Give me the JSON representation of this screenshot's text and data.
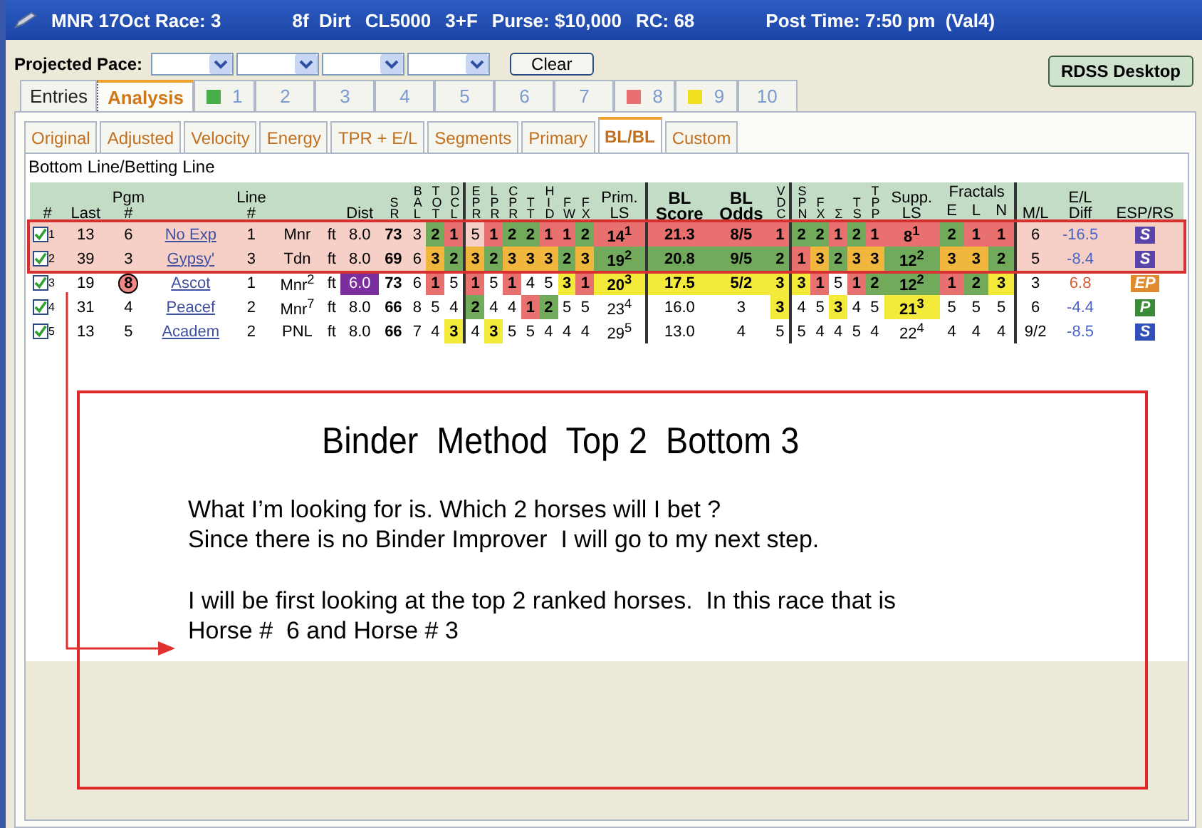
{
  "title_bar": {
    "parts": [
      "MNR 17Oct Race: 3",
      "8f  Dirt",
      "CL5000",
      "3+F",
      "Purse: $10,000",
      "RC: 68",
      "Post Time: 7:50 pm  (Val4)"
    ]
  },
  "toolbar": {
    "label": "Projected Pace:",
    "selects": [
      {
        "kind": "dropdown"
      },
      {
        "kind": "dropdown"
      },
      {
        "kind": "dropdown"
      },
      {
        "kind": "dropdown"
      }
    ],
    "clear_button": "Clear",
    "desktop_button": "RDSS Desktop"
  },
  "tabs": [
    {
      "label": "Entries",
      "selected": false
    },
    {
      "label": "Analysis",
      "selected": true
    },
    {
      "label": "1",
      "selected": false,
      "color": "#48b048"
    },
    {
      "label": "2",
      "selected": false
    },
    {
      "label": "3",
      "selected": false
    },
    {
      "label": "4",
      "selected": false
    },
    {
      "label": "5",
      "selected": false
    },
    {
      "label": "6",
      "selected": false
    },
    {
      "label": "7",
      "selected": false
    },
    {
      "label": "8",
      "selected": false,
      "color": "#e87070"
    },
    {
      "label": "9",
      "selected": false,
      "color": "#f2e020"
    },
    {
      "label": "10",
      "selected": false
    }
  ],
  "subtabs": [
    {
      "label": "Original",
      "selected": false
    },
    {
      "label": "Adjusted",
      "selected": false
    },
    {
      "label": "Velocity",
      "selected": false
    },
    {
      "label": "Energy",
      "selected": false
    },
    {
      "label": "TPR + E/L",
      "selected": false
    },
    {
      "label": "Segments",
      "selected": false
    },
    {
      "label": "Primary",
      "selected": false
    },
    {
      "label": "BL/BL",
      "selected": true
    },
    {
      "label": "Custom",
      "selected": false
    }
  ],
  "section_title": "Bottom Line/Betting Line",
  "table": {
    "columns": [
      {
        "label": "#",
        "kind": "plain"
      },
      {
        "label": "Last",
        "kind": "plain"
      },
      {
        "lines": [
          "Pgm",
          "#"
        ],
        "kind": "lines"
      },
      {
        "kind": "blank"
      },
      {
        "lines": [
          "Line",
          "#"
        ],
        "kind": "lines"
      },
      {
        "kind": "blank"
      },
      {
        "kind": "blank"
      },
      {
        "label": "Dist",
        "kind": "plain"
      },
      {
        "label": "SR",
        "kind": "stack",
        "bold": true
      },
      {
        "label": "BAL",
        "kind": "stack"
      },
      {
        "label": "TOT",
        "kind": "stack"
      },
      {
        "label": "DCL",
        "kind": "stack"
      },
      {
        "label": "EPR",
        "kind": "stack",
        "divider": true
      },
      {
        "label": "LPR",
        "kind": "stack"
      },
      {
        "label": "CPR",
        "kind": "stack"
      },
      {
        "label": "TT",
        "kind": "stack"
      },
      {
        "label": "HID",
        "kind": "stack"
      },
      {
        "label": "FW",
        "kind": "stack"
      },
      {
        "label": "FX",
        "kind": "stack"
      },
      {
        "lines": [
          "Prim.",
          "LS"
        ],
        "kind": "lines"
      },
      {
        "lines": [
          "BL",
          "Score"
        ],
        "kind": "strong",
        "divider": true
      },
      {
        "lines": [
          "BL",
          "Odds"
        ],
        "kind": "strong"
      },
      {
        "label": "VDC",
        "kind": "stack"
      },
      {
        "label": "SPN",
        "kind": "stack",
        "divider": true
      },
      {
        "label": "FX",
        "kind": "stack"
      },
      {
        "label": "Σ",
        "kind": "stack"
      },
      {
        "label": "TS",
        "kind": "stack"
      },
      {
        "label": "TPP",
        "kind": "stack"
      },
      {
        "lines": [
          "Supp.",
          "LS"
        ],
        "kind": "lines"
      },
      {
        "label": "E",
        "kind": "plain",
        "grouped": true
      },
      {
        "label": "L",
        "kind": "plain",
        "grouped": true
      },
      {
        "label": "N",
        "kind": "plain",
        "grouped": true
      },
      {
        "label": "M/L",
        "kind": "plain",
        "divider": true
      },
      {
        "lines": [
          "E/L",
          "Diff"
        ],
        "kind": "lines"
      },
      {
        "label": "ESP/RS",
        "kind": "plain"
      }
    ],
    "column_groups": [
      {
        "label": "Fractals"
      }
    ],
    "rows": [
      {
        "highlighted": true,
        "cells": [
          {
            "text": "1",
            "kind": "check",
            "checked": true
          },
          "13",
          "6",
          {
            "text": "No Exp",
            "kind": "link"
          },
          "1",
          "Mnr",
          "ft",
          "8.0",
          "73",
          "3",
          {
            "text": "2",
            "color": "#72aa5c"
          },
          {
            "text": "1",
            "color": "#e8716f"
          },
          "5",
          {
            "text": "1",
            "color": "#e8716f"
          },
          {
            "text": "2",
            "color": "#72aa5c"
          },
          {
            "text": "2",
            "color": "#72aa5c"
          },
          {
            "text": "1",
            "color": "#e8716f"
          },
          {
            "text": "1",
            "color": "#e8716f"
          },
          {
            "text": "2",
            "color": "#72aa5c"
          },
          {
            "text": "14$^{1}$",
            "color": "#e8716f"
          },
          {
            "text": "21.3",
            "color": "#e8716f"
          },
          {
            "text": "8/5",
            "color": "#e8716f"
          },
          {
            "text": "1",
            "color": "#e8716f"
          },
          {
            "text": "2",
            "color": "#72aa5c"
          },
          {
            "text": "2",
            "color": "#72aa5c"
          },
          {
            "text": "1",
            "color": "#e8716f"
          },
          {
            "text": "2",
            "color": "#72aa5c"
          },
          {
            "text": "1",
            "color": "#e8716f"
          },
          {
            "text": "8$^{1}$",
            "color": "#e8716f"
          },
          {
            "text": "2",
            "color": "#72aa5c"
          },
          {
            "text": "1",
            "color": "#e8716f"
          },
          {
            "text": "1",
            "color": "#e8716f"
          },
          "6",
          {
            "text": "-16.5",
            "kind": "diff",
            "color": "#4a64c8"
          },
          {
            "text": "S",
            "kind": "badge",
            "color": "#5a46a8"
          }
        ]
      },
      {
        "highlighted": true,
        "cells": [
          {
            "text": "2",
            "kind": "check",
            "checked": true
          },
          "39",
          "3",
          {
            "text": "Gypsy'",
            "kind": "link"
          },
          "3",
          "Tdn",
          "ft",
          "8.0",
          "69",
          "6",
          {
            "text": "3",
            "color": "#f1b63e"
          },
          {
            "text": "2",
            "color": "#72aa5c"
          },
          {
            "text": "3",
            "color": "#f1b63e"
          },
          {
            "text": "2",
            "color": "#72aa5c"
          },
          {
            "text": "3",
            "color": "#f1b63e"
          },
          {
            "text": "3",
            "color": "#f1b63e"
          },
          {
            "text": "3",
            "color": "#f1b63e"
          },
          {
            "text": "2",
            "color": "#72aa5c"
          },
          {
            "text": "3",
            "color": "#f1b63e"
          },
          {
            "text": "19$^{2}$",
            "color": "#72aa5c"
          },
          {
            "text": "20.8",
            "color": "#72aa5c"
          },
          {
            "text": "9/5",
            "color": "#72aa5c"
          },
          {
            "text": "2",
            "color": "#72aa5c"
          },
          {
            "text": "1",
            "color": "#e8716f"
          },
          {
            "text": "3",
            "color": "#f1b63e"
          },
          {
            "text": "2",
            "color": "#72aa5c"
          },
          {
            "text": "3",
            "color": "#f1b63e"
          },
          {
            "text": "3",
            "color": "#f1b63e"
          },
          {
            "text": "12$^{2}$",
            "color": "#72aa5c"
          },
          {
            "text": "3",
            "color": "#f1b63e"
          },
          {
            "text": "3",
            "color": "#f1b63e"
          },
          {
            "text": "2",
            "color": "#72aa5c"
          },
          "5",
          {
            "text": "-8.4",
            "kind": "diff",
            "color": "#4a64c8"
          },
          {
            "text": "S",
            "kind": "badge",
            "color": "#5a46a8"
          }
        ]
      },
      {
        "highlighted": false,
        "cells": [
          {
            "text": "3",
            "kind": "check",
            "checked": true
          },
          "19",
          {
            "text": "8",
            "kind": "circled"
          },
          {
            "text": "Ascot",
            "kind": "link"
          },
          "1",
          "Mnr$^{2}$",
          "ft",
          {
            "text": "6.0",
            "kind": "dark",
            "color": "#7b2f9e"
          },
          "73",
          "6",
          {
            "text": "1",
            "color": "#e8716f"
          },
          "5",
          {
            "text": "1",
            "color": "#e8716f"
          },
          "5",
          {
            "text": "1",
            "color": "#e8716f"
          },
          "4",
          "5",
          {
            "text": "3",
            "color": "#f4ea3c"
          },
          {
            "text": "1",
            "color": "#e8716f"
          },
          {
            "text": "20$^{3}$",
            "color": "#f4ea3c"
          },
          {
            "text": "17.5",
            "color": "#f4ea3c"
          },
          {
            "text": "5/2",
            "color": "#f4ea3c"
          },
          {
            "text": "3",
            "color": "#f4ea3c"
          },
          {
            "text": "3",
            "color": "#f4ea3c"
          },
          {
            "text": "1",
            "color": "#e8716f"
          },
          "5",
          {
            "text": "1",
            "color": "#e8716f"
          },
          {
            "text": "2",
            "color": "#72aa5c"
          },
          {
            "text": "12$^{2}$",
            "color": "#72aa5c"
          },
          {
            "text": "1",
            "color": "#e8716f"
          },
          {
            "text": "2",
            "color": "#72aa5c"
          },
          {
            "text": "3",
            "color": "#f4ea3c"
          },
          "3",
          {
            "text": "6.8",
            "kind": "diff",
            "color": "#d85a30"
          },
          {
            "text": "EP",
            "kind": "badge",
            "color": "#e08a30"
          }
        ]
      },
      {
        "highlighted": false,
        "cells": [
          {
            "text": "4",
            "kind": "check",
            "checked": true
          },
          "31",
          "4",
          {
            "text": "Peacef",
            "kind": "link"
          },
          "2",
          "Mnr$^{7}$",
          "ft",
          "8.0",
          "66",
          "8",
          "5",
          "4",
          {
            "text": "2",
            "color": "#72aa5c"
          },
          "4",
          "4",
          {
            "text": "1",
            "color": "#e8716f"
          },
          {
            "text": "2",
            "color": "#72aa5c"
          },
          "5",
          "5",
          "23$^{4}$",
          "16.0",
          "3",
          {
            "text": "3",
            "color": "#f4ea3c"
          },
          "4",
          "5",
          {
            "text": "3",
            "color": "#f4ea3c"
          },
          "4",
          "5",
          {
            "text": "21$^{3}$",
            "color": "#f4ea3c"
          },
          "5",
          "5",
          "5",
          "6",
          {
            "text": "-4.4",
            "kind": "diff",
            "color": "#4a64c8"
          },
          {
            "text": "P",
            "kind": "badge",
            "color": "#3a8a3a"
          }
        ]
      },
      {
        "highlighted": false,
        "cells": [
          {
            "text": "5",
            "kind": "check",
            "checked": true
          },
          "13",
          "5",
          {
            "text": "Academ",
            "kind": "link"
          },
          "2",
          "PNL",
          "ft",
          "8.0",
          "66",
          "7",
          "4",
          {
            "text": "3",
            "color": "#f4ea3c"
          },
          "4",
          {
            "text": "3",
            "color": "#f4ea3c"
          },
          "5",
          "5",
          "4",
          "4",
          "4",
          "29$^{5}$",
          "13.0",
          "4",
          "5",
          "5",
          "4",
          "4",
          "5",
          "4",
          "22$^{4}$",
          "4",
          "4",
          "4",
          "9/2",
          {
            "text": "-8.5",
            "kind": "diff",
            "color": "#4a64c8"
          },
          {
            "text": "S",
            "kind": "badge",
            "color": "#3050b8"
          }
        ]
      }
    ]
  },
  "annotation": {
    "title": "Binder  Method  Top 2  Bottom 3",
    "paragraphs": [
      [
        "What I’m looking for is. Which 2 horses will I bet ?",
        "Since there is no Binder Improver  I will go to my next step."
      ],
      [
        "I will be first looking at the top 2 ranked horses.  In this race that is",
        "Horse #  6 and Horse # 3"
      ]
    ]
  }
}
